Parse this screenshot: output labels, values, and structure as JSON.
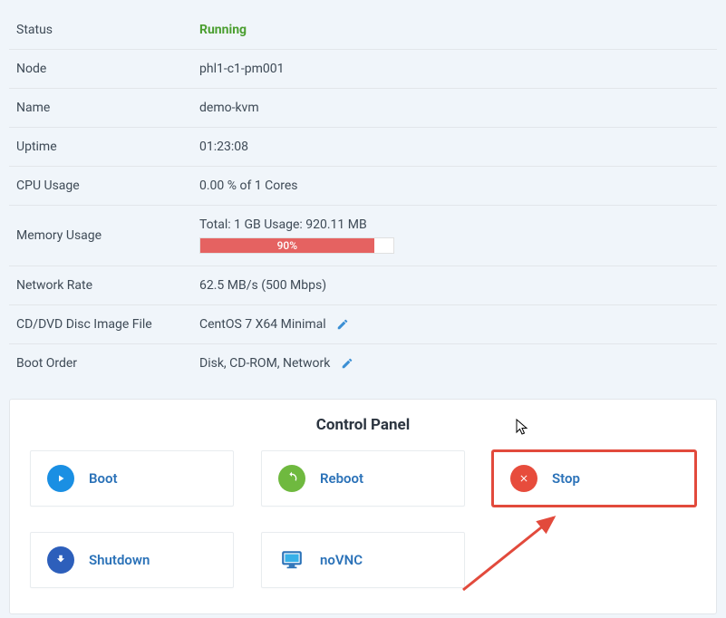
{
  "info": {
    "status_label": "Status",
    "status_value": "Running",
    "node_label": "Node",
    "node_value": "phl1-c1-pm001",
    "name_label": "Name",
    "name_value": "demo-kvm",
    "uptime_label": "Uptime",
    "uptime_value": "01:23:08",
    "cpu_label": "CPU Usage",
    "cpu_value": "0.00 % of 1 Cores",
    "memory_label": "Memory Usage",
    "memory_text": "Total: 1 GB Usage: 920.11 MB",
    "memory_percent_label": "90%",
    "memory_percent": 90,
    "network_label": "Network Rate",
    "network_value": "62.5 MB/s (500 Mbps)",
    "disc_label": "CD/DVD Disc Image File",
    "disc_value": "CentOS 7 X64 Minimal",
    "boot_label": "Boot Order",
    "boot_value": "Disk, CD-ROM, Network"
  },
  "panel": {
    "title": "Control Panel",
    "boot": "Boot",
    "reboot": "Reboot",
    "stop": "Stop",
    "shutdown": "Shutdown",
    "novnc": "noVNC"
  },
  "colors": {
    "running": "#4a9e2f",
    "progress": "#e56261",
    "link": "#2b72b8",
    "highlight": "#e24a3c"
  }
}
